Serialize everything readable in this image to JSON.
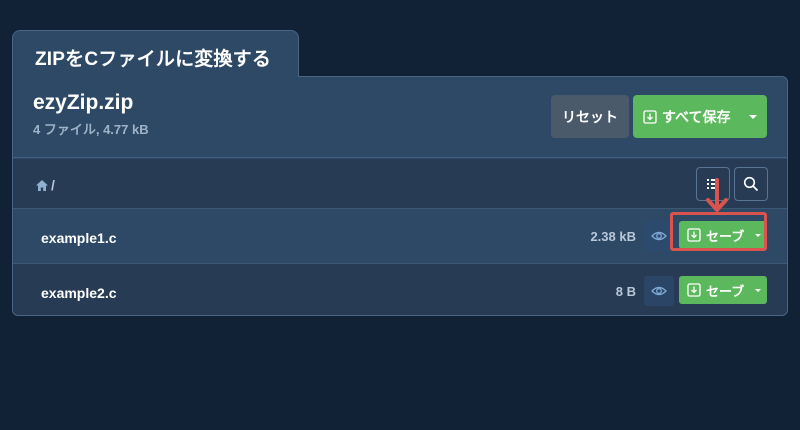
{
  "tab": {
    "title": "ZIPをCファイルに変換する"
  },
  "archive": {
    "name": "ezyZip.zip",
    "meta": "4 ファイル, 4.77 kB"
  },
  "buttons": {
    "reset": "リセット",
    "save_all": "すべて保存"
  },
  "breadcrumb": {
    "separator": "/"
  },
  "files": [
    {
      "name": "example1.c",
      "size": "2.38 kB",
      "save": "セーブ"
    },
    {
      "name": "example2.c",
      "size": "8 B",
      "save": "セーブ"
    }
  ],
  "colors": {
    "background": "#112236",
    "panel": "#2e4966",
    "success": "#5cb85c",
    "reset": "#4a5a6b",
    "highlight": "#d9534f"
  }
}
